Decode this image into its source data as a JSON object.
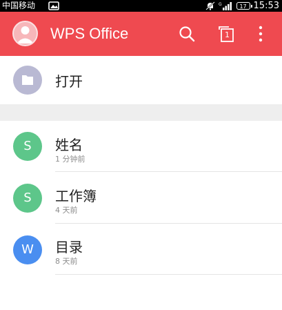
{
  "status_bar": {
    "carrier": "中国移动",
    "battery": "17",
    "time": "15:53"
  },
  "app_bar": {
    "title": "WPS Office",
    "tab_count": "1"
  },
  "open_item": {
    "label": "打开"
  },
  "recent_files": [
    {
      "name": "姓名",
      "time": "1 分钟前",
      "app": "spreadsheet",
      "icon": "S",
      "color": "#5dc68a"
    },
    {
      "name": "工作簿",
      "time": "4 天前",
      "app": "spreadsheet",
      "icon": "S",
      "color": "#5dc68a"
    },
    {
      "name": "目录",
      "time": "8 天前",
      "app": "writer",
      "icon": "W",
      "color": "#4a8ef0"
    }
  ],
  "colors": {
    "accent": "#ef4a50",
    "open_circle": "#b9b9d3",
    "spreadsheet": "#5dc68a",
    "writer": "#4a8ef0"
  }
}
